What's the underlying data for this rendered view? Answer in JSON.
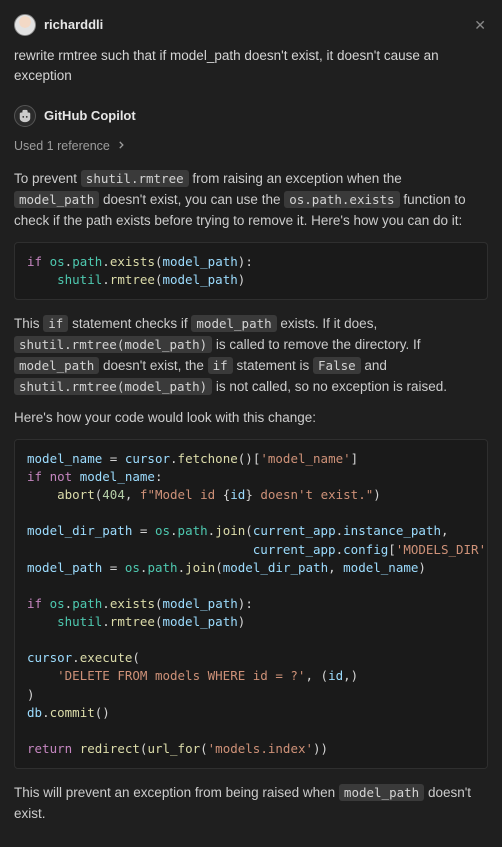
{
  "user_message": {
    "author": "richarddli",
    "text": "rewrite rmtree such that if model_path doesn't exist, it doesn't cause an exception"
  },
  "assistant_message": {
    "author": "GitHub Copilot",
    "references_label": "Used 1 reference",
    "para1": {
      "pre": "To prevent ",
      "c1": "shutil.rmtree",
      "mid1": " from raising an exception when the ",
      "c2": "model_path",
      "mid2": " doesn't exist, you can use the ",
      "c3": "os.path.exists",
      "post": " function to check if the path exists before trying to remove it. Here's how you can do it:"
    },
    "code1": {
      "kw_if": "if",
      "os": "os",
      "path": "path",
      "exists": "exists",
      "model_path": "model_path",
      "shutil": "shutil",
      "rmtree": "rmtree"
    },
    "para2": {
      "pre": "This ",
      "c1": "if",
      "mid1": " statement checks if ",
      "c2": "model_path",
      "mid2": " exists. If it does, ",
      "c3": "shutil.rmtree(model_path)",
      "mid3": " is called to remove the directory. If ",
      "c4": "model_path",
      "mid4": " doesn't exist, the ",
      "c5": "if",
      "mid5": " statement is ",
      "c6": "False",
      "mid6": " and ",
      "c7": "shutil.rmtree(model_path)",
      "post": " is not called, so no exception is raised."
    },
    "para3": "Here's how your code would look with this change:",
    "code2": {
      "model_name": "model_name",
      "cursor": "cursor",
      "fetchone": "fetchone",
      "key_model_name": "'model_name'",
      "kw_if": "if",
      "kw_not": "not",
      "abort": "abort",
      "n404": "404",
      "fstr_pre": "f\"Model id ",
      "id": "id",
      "fstr_post": " doesn't exist.\"",
      "model_dir_path": "model_dir_path",
      "os": "os",
      "path": "path",
      "join": "join",
      "current_app": "current_app",
      "instance_path": "instance_path",
      "config": "config",
      "models_dir": "'MODELS_DIR'",
      "model_path": "model_path",
      "exists": "exists",
      "shutil": "shutil",
      "rmtree": "rmtree",
      "execute": "execute",
      "sql": "'DELETE FROM models WHERE id = ?'",
      "db": "db",
      "commit": "commit",
      "kw_return": "return",
      "redirect": "redirect",
      "url_for": "url_for",
      "models_index": "'models.index'"
    },
    "para4": {
      "pre": "This will prevent an exception from being raised when ",
      "c1": "model_path",
      "post": " doesn't exist."
    }
  }
}
